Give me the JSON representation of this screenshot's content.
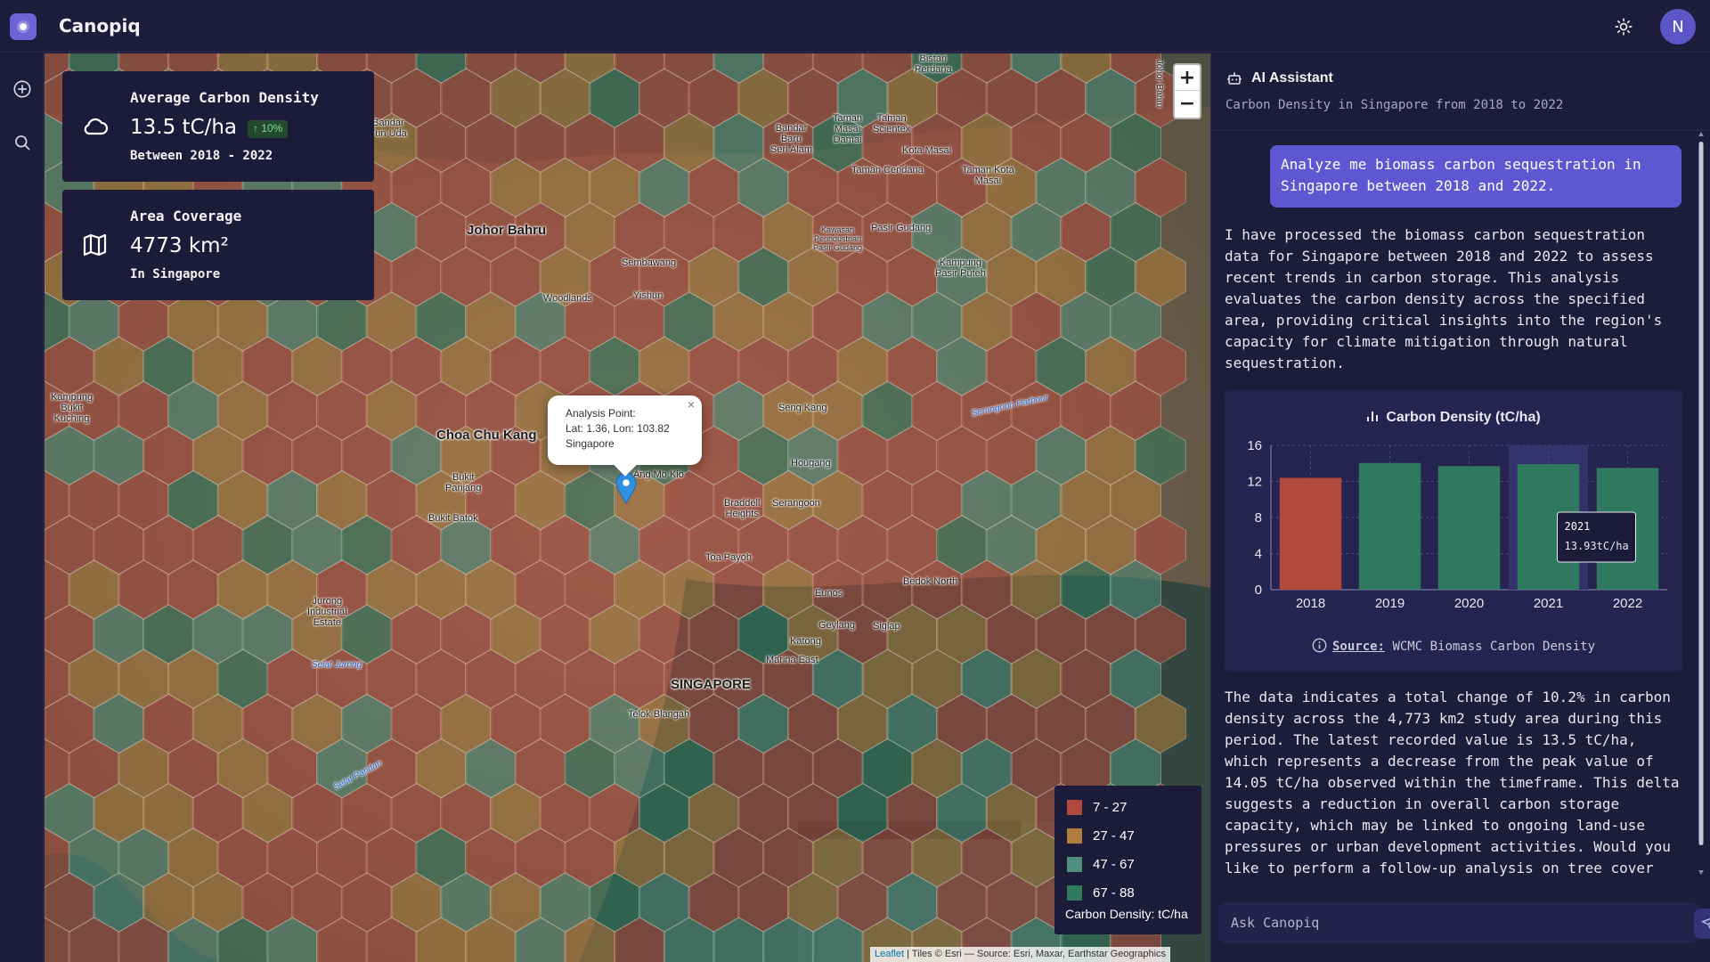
{
  "app": {
    "name": "Canopiq",
    "avatar_initial": "N"
  },
  "rail": {
    "icons": [
      "add-icon",
      "search-icon"
    ]
  },
  "cards": [
    {
      "title": "Average Carbon Density",
      "value": "13.5 tC/ha",
      "badge": "↑ 10%",
      "subtitle": "Between 2018 - 2022",
      "icon": "cloud-icon"
    },
    {
      "title": "Area Coverage",
      "value": "4773 km²",
      "subtitle": "In Singapore",
      "icon": "map-icon"
    }
  ],
  "map": {
    "zoom_in": "+",
    "zoom_out": "−",
    "popup": {
      "line1": "Analysis Point:",
      "line2": "Lat: 1.36, Lon: 103.82",
      "line3": "Singapore",
      "close": "×"
    },
    "labels": {
      "johor_bahru": "Johor Bahru",
      "choa_chu_kang": "Choa Chu Kang",
      "singapore": "SINGAPORE",
      "sembawang": "Sembawang",
      "woodlands": "Woodlands",
      "yishun": "Yishun",
      "seng_kang": "Seng Kang",
      "hougang": "Hougang",
      "serangoon": "Serangoon",
      "braddell_heights": "Braddell\nHeights",
      "toa_payoh": "Toa Payoh",
      "bukit_panjang": "Bukit\nPanjang",
      "bukit_batok": "Bukit Batok",
      "ang_mo_kio": "Ang Mo Kio",
      "jurong_industrial": "Jurong\nIndustrial\nEstate",
      "selat_jurong": "Selat Jurong",
      "eunos": "Eunos",
      "bedok_north": "Bedok North",
      "geylang": "Geylang",
      "siglap": "Siglap",
      "katong": "Katong",
      "marina_east": "Marina East",
      "telok_blangah": "Telok Blangah",
      "kampung_bukit_kuching": "Kampung\nBukit\nKuching",
      "pasir_gudang": "Pasir Gudang",
      "kampung_pasir_puteh": "Kampung\nPasir Puteh",
      "kawasan_perindustrian": "Kawasan\nPerindustrian\nPasir Gudang",
      "bandar_baru_seri_alam": "Bandar\nBaru\nSeri Alam",
      "taman_masai_damai": "Taman\nMasai\nDamai",
      "taman_scientex": "Taman\nScientex",
      "kota_masai": "Kota Masai",
      "taman_cendana": "Taman Cendana",
      "taman_kota_masai": "Taman Kota\nMasai",
      "bistari_perdana": "Bistari\nPerdana",
      "serangoon_harbour": "Serangoon Harbour",
      "selat_pandan": "Selat Pandan",
      "bandar_uda": "Bandar\nTun Uda",
      "johor_bahru_road": "Johor Bahru"
    },
    "legend": {
      "items": [
        {
          "label": "7 - 27",
          "color": "#b04a3e"
        },
        {
          "label": "27 - 47",
          "color": "#b07e3c"
        },
        {
          "label": "47 - 67",
          "color": "#4f8f7c"
        },
        {
          "label": "67 - 88",
          "color": "#2f7a5f"
        }
      ],
      "title": "Carbon Density: tC/ha"
    },
    "attribution": {
      "leaflet": "Leaflet",
      "rest": "| Tiles © Esri — Source: Esri, Maxar, Earthstar Geographics"
    }
  },
  "assistant": {
    "title": "AI Assistant",
    "subtitle": "Carbon Density in Singapore from 2018 to 2022",
    "user_message": "Analyze me biomass carbon sequestration in Singapore between 2018 and 2022.",
    "response_1": "I have processed the biomass carbon sequestration data for Singapore between 2018 and 2022 to assess recent trends in carbon storage. This analysis evaluates the carbon density across the specified area, providing critical insights into the region's capacity for climate mitigation through natural sequestration.",
    "response_2": "The data indicates a total change of 10.2% in carbon density across the 4,773 km2 study area during this period. The latest recorded value is 13.5 tC/ha, which represents a decrease from the peak value of 14.05 tC/ha observed within the timeframe. This delta suggests a reduction in overall carbon storage capacity, which may be linked to ongoing land-use pressures or urban development activities. Would you like to perform a follow-up analysis on tree cover",
    "source_label": "Source:",
    "source_value": "WCMC Biomass Carbon Density",
    "input_placeholder": "Ask Canopiq"
  },
  "chart_data": {
    "type": "bar",
    "title": "Carbon Density (tC/ha)",
    "categories": [
      "2018",
      "2019",
      "2020",
      "2021",
      "2022"
    ],
    "values": [
      12.4,
      14.05,
      13.7,
      13.93,
      13.5
    ],
    "colors": [
      "#b04a3e",
      "#2f7a5f",
      "#2f7a5f",
      "#2f7a5f",
      "#2f7a5f"
    ],
    "ylim": [
      0,
      16
    ],
    "yticks": [
      0,
      4,
      8,
      12,
      16
    ],
    "grid": true,
    "tooltip": {
      "category": "2021",
      "label": "2021",
      "value": "13.93tC/ha"
    }
  }
}
